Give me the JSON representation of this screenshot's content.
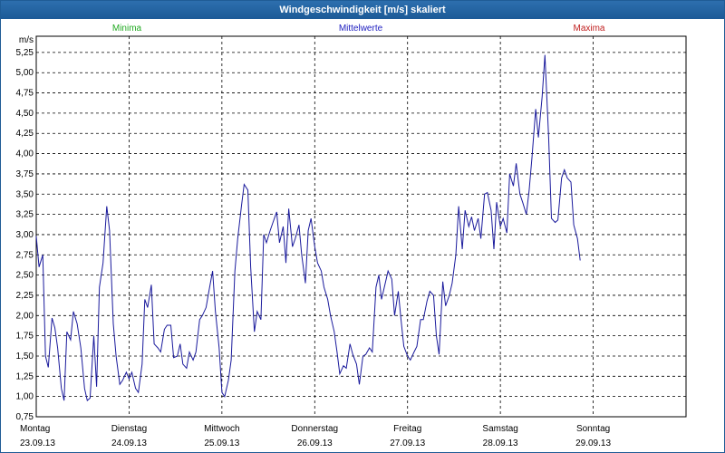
{
  "window": {
    "title": "Windgeschwindigkeit [m/s] skaliert"
  },
  "legend": [
    {
      "label": "Minima",
      "color": "#22aa22"
    },
    {
      "label": "Mittelwerte",
      "color": "#2020c0"
    },
    {
      "label": "Maxima",
      "color": "#c02020"
    }
  ],
  "chart_data": {
    "type": "line",
    "ylabel": "m/s",
    "ylim": [
      0.75,
      5.45
    ],
    "yticks": [
      "0,75",
      "1,00",
      "1,25",
      "1,50",
      "1,75",
      "2,00",
      "2,25",
      "2,50",
      "2,75",
      "3,00",
      "3,25",
      "3,50",
      "3,75",
      "4,00",
      "4,25",
      "4,50",
      "4,75",
      "5,00",
      "5,25"
    ],
    "ytick_values": [
      0.75,
      1.0,
      1.25,
      1.5,
      1.75,
      2.0,
      2.25,
      2.5,
      2.75,
      3.0,
      3.25,
      3.5,
      3.75,
      4.0,
      4.25,
      4.5,
      4.75,
      5.0,
      5.25
    ],
    "grid": true,
    "xlim": [
      0,
      7
    ],
    "x_categories": [
      {
        "day": "Montag",
        "date": "23.09.13"
      },
      {
        "day": "Dienstag",
        "date": "24.09.13"
      },
      {
        "day": "Mittwoch",
        "date": "25.09.13"
      },
      {
        "day": "Donnerstag",
        "date": "26.09.13"
      },
      {
        "day": "Freitag",
        "date": "27.09.13"
      },
      {
        "day": "Samstag",
        "date": "28.09.13"
      },
      {
        "day": "Sonntag",
        "date": "29.09.13"
      }
    ],
    "series": [
      {
        "name": "Mittelwerte",
        "color": "#1a1a9c",
        "points": [
          [
            0.0,
            2.98
          ],
          [
            0.03,
            2.6
          ],
          [
            0.07,
            2.75
          ],
          [
            0.1,
            1.5
          ],
          [
            0.13,
            1.36
          ],
          [
            0.17,
            1.97
          ],
          [
            0.2,
            1.85
          ],
          [
            0.23,
            1.6
          ],
          [
            0.27,
            1.1
          ],
          [
            0.3,
            0.95
          ],
          [
            0.33,
            1.8
          ],
          [
            0.37,
            1.7
          ],
          [
            0.4,
            2.05
          ],
          [
            0.44,
            1.9
          ],
          [
            0.48,
            1.6
          ],
          [
            0.52,
            1.1
          ],
          [
            0.55,
            0.95
          ],
          [
            0.58,
            0.98
          ],
          [
            0.62,
            1.75
          ],
          [
            0.65,
            1.12
          ],
          [
            0.68,
            2.35
          ],
          [
            0.72,
            2.65
          ],
          [
            0.76,
            3.35
          ],
          [
            0.79,
            3.05
          ],
          [
            0.83,
            1.9
          ],
          [
            0.86,
            1.5
          ],
          [
            0.9,
            1.15
          ],
          [
            0.93,
            1.2
          ],
          [
            0.97,
            1.3
          ],
          [
            1.0,
            1.22
          ],
          [
            1.03,
            1.3
          ],
          [
            1.07,
            1.1
          ],
          [
            1.1,
            1.05
          ],
          [
            1.14,
            1.4
          ],
          [
            1.17,
            2.2
          ],
          [
            1.2,
            2.1
          ],
          [
            1.24,
            2.38
          ],
          [
            1.27,
            1.65
          ],
          [
            1.31,
            1.6
          ],
          [
            1.34,
            1.55
          ],
          [
            1.38,
            1.83
          ],
          [
            1.41,
            1.88
          ],
          [
            1.45,
            1.88
          ],
          [
            1.48,
            1.48
          ],
          [
            1.52,
            1.5
          ],
          [
            1.55,
            1.65
          ],
          [
            1.58,
            1.4
          ],
          [
            1.62,
            1.35
          ],
          [
            1.65,
            1.55
          ],
          [
            1.69,
            1.45
          ],
          [
            1.72,
            1.55
          ],
          [
            1.76,
            1.95
          ],
          [
            1.79,
            2.0
          ],
          [
            1.83,
            2.1
          ],
          [
            1.86,
            2.3
          ],
          [
            1.9,
            2.55
          ],
          [
            1.93,
            2.05
          ],
          [
            1.97,
            1.6
          ],
          [
            2.0,
            1.05
          ],
          [
            2.03,
            1.0
          ],
          [
            2.07,
            1.2
          ],
          [
            2.1,
            1.45
          ],
          [
            2.14,
            2.55
          ],
          [
            2.17,
            2.95
          ],
          [
            2.21,
            3.35
          ],
          [
            2.24,
            3.62
          ],
          [
            2.28,
            3.55
          ],
          [
            2.31,
            2.6
          ],
          [
            2.35,
            1.8
          ],
          [
            2.38,
            2.05
          ],
          [
            2.42,
            1.95
          ],
          [
            2.45,
            3.0
          ],
          [
            2.48,
            2.9
          ],
          [
            2.52,
            3.05
          ],
          [
            2.55,
            3.15
          ],
          [
            2.59,
            3.28
          ],
          [
            2.62,
            2.9
          ],
          [
            2.66,
            3.1
          ],
          [
            2.69,
            2.65
          ],
          [
            2.72,
            3.32
          ],
          [
            2.76,
            2.85
          ],
          [
            2.79,
            2.95
          ],
          [
            2.83,
            3.12
          ],
          [
            2.86,
            2.75
          ],
          [
            2.9,
            2.4
          ],
          [
            2.93,
            3.05
          ],
          [
            2.96,
            3.2
          ],
          [
            3.0,
            2.85
          ],
          [
            3.03,
            2.65
          ],
          [
            3.07,
            2.55
          ],
          [
            3.1,
            2.35
          ],
          [
            3.14,
            2.2
          ],
          [
            3.17,
            2.0
          ],
          [
            3.21,
            1.8
          ],
          [
            3.24,
            1.55
          ],
          [
            3.27,
            1.28
          ],
          [
            3.31,
            1.38
          ],
          [
            3.34,
            1.35
          ],
          [
            3.38,
            1.65
          ],
          [
            3.41,
            1.52
          ],
          [
            3.45,
            1.4
          ],
          [
            3.48,
            1.15
          ],
          [
            3.52,
            1.5
          ],
          [
            3.55,
            1.52
          ],
          [
            3.59,
            1.6
          ],
          [
            3.62,
            1.55
          ],
          [
            3.66,
            2.35
          ],
          [
            3.69,
            2.5
          ],
          [
            3.72,
            2.2
          ],
          [
            3.76,
            2.4
          ],
          [
            3.79,
            2.55
          ],
          [
            3.83,
            2.45
          ],
          [
            3.86,
            2.0
          ],
          [
            3.9,
            2.3
          ],
          [
            3.93,
            1.95
          ],
          [
            3.96,
            1.62
          ],
          [
            4.0,
            1.5
          ],
          [
            4.03,
            1.45
          ],
          [
            4.07,
            1.55
          ],
          [
            4.1,
            1.62
          ],
          [
            4.14,
            1.95
          ],
          [
            4.17,
            1.95
          ],
          [
            4.21,
            2.18
          ],
          [
            4.24,
            2.3
          ],
          [
            4.28,
            2.25
          ],
          [
            4.31,
            1.75
          ],
          [
            4.34,
            1.52
          ],
          [
            4.38,
            2.42
          ],
          [
            4.41,
            2.12
          ],
          [
            4.45,
            2.25
          ],
          [
            4.48,
            2.4
          ],
          [
            4.52,
            2.75
          ],
          [
            4.55,
            3.35
          ],
          [
            4.59,
            2.82
          ],
          [
            4.62,
            3.3
          ],
          [
            4.66,
            3.1
          ],
          [
            4.69,
            3.22
          ],
          [
            4.72,
            3.05
          ],
          [
            4.76,
            3.2
          ],
          [
            4.79,
            2.95
          ],
          [
            4.83,
            3.5
          ],
          [
            4.86,
            3.52
          ],
          [
            4.9,
            3.3
          ],
          [
            4.93,
            2.82
          ],
          [
            4.96,
            3.4
          ],
          [
            5.0,
            3.1
          ],
          [
            5.03,
            3.2
          ],
          [
            5.07,
            3.02
          ],
          [
            5.1,
            3.75
          ],
          [
            5.14,
            3.6
          ],
          [
            5.17,
            3.88
          ],
          [
            5.21,
            3.5
          ],
          [
            5.24,
            3.4
          ],
          [
            5.28,
            3.25
          ],
          [
            5.31,
            3.55
          ],
          [
            5.34,
            3.95
          ],
          [
            5.38,
            4.55
          ],
          [
            5.41,
            4.2
          ],
          [
            5.45,
            4.7
          ],
          [
            5.48,
            5.22
          ],
          [
            5.52,
            4.2
          ],
          [
            5.55,
            3.2
          ],
          [
            5.59,
            3.15
          ],
          [
            5.62,
            3.18
          ],
          [
            5.66,
            3.7
          ],
          [
            5.69,
            3.8
          ],
          [
            5.72,
            3.7
          ],
          [
            5.76,
            3.65
          ],
          [
            5.79,
            3.12
          ],
          [
            5.83,
            2.95
          ],
          [
            5.86,
            2.68
          ]
        ]
      }
    ]
  }
}
